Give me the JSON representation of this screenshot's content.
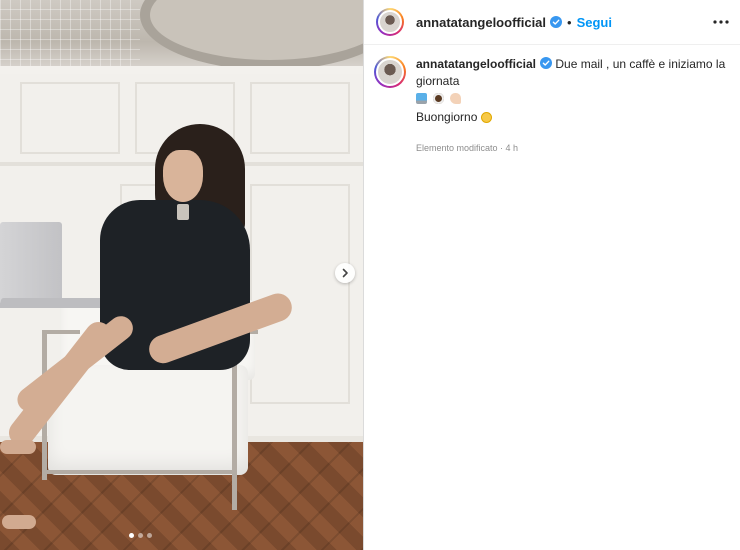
{
  "post": {
    "username": "annatatangeloofficial",
    "separator": "•",
    "follow_label": "Segui",
    "caption": {
      "username": "annatatangeloofficial",
      "text": "Due mail , un caffè e iniziamo la giornata",
      "emojis": [
        "laptop-emoji",
        "coffee-emoji",
        "flexed-biceps-emoji"
      ],
      "greeting": "Buongiorno",
      "greeting_emoji": "sun-emoji",
      "meta": "Elemento modificato · 4 h"
    },
    "carousel": {
      "slides": 3,
      "active_slide": 1
    }
  },
  "colors": {
    "accent": "#0095f6",
    "verified": "#3897f0",
    "text": "#262626",
    "muted": "#8e8e8e"
  }
}
